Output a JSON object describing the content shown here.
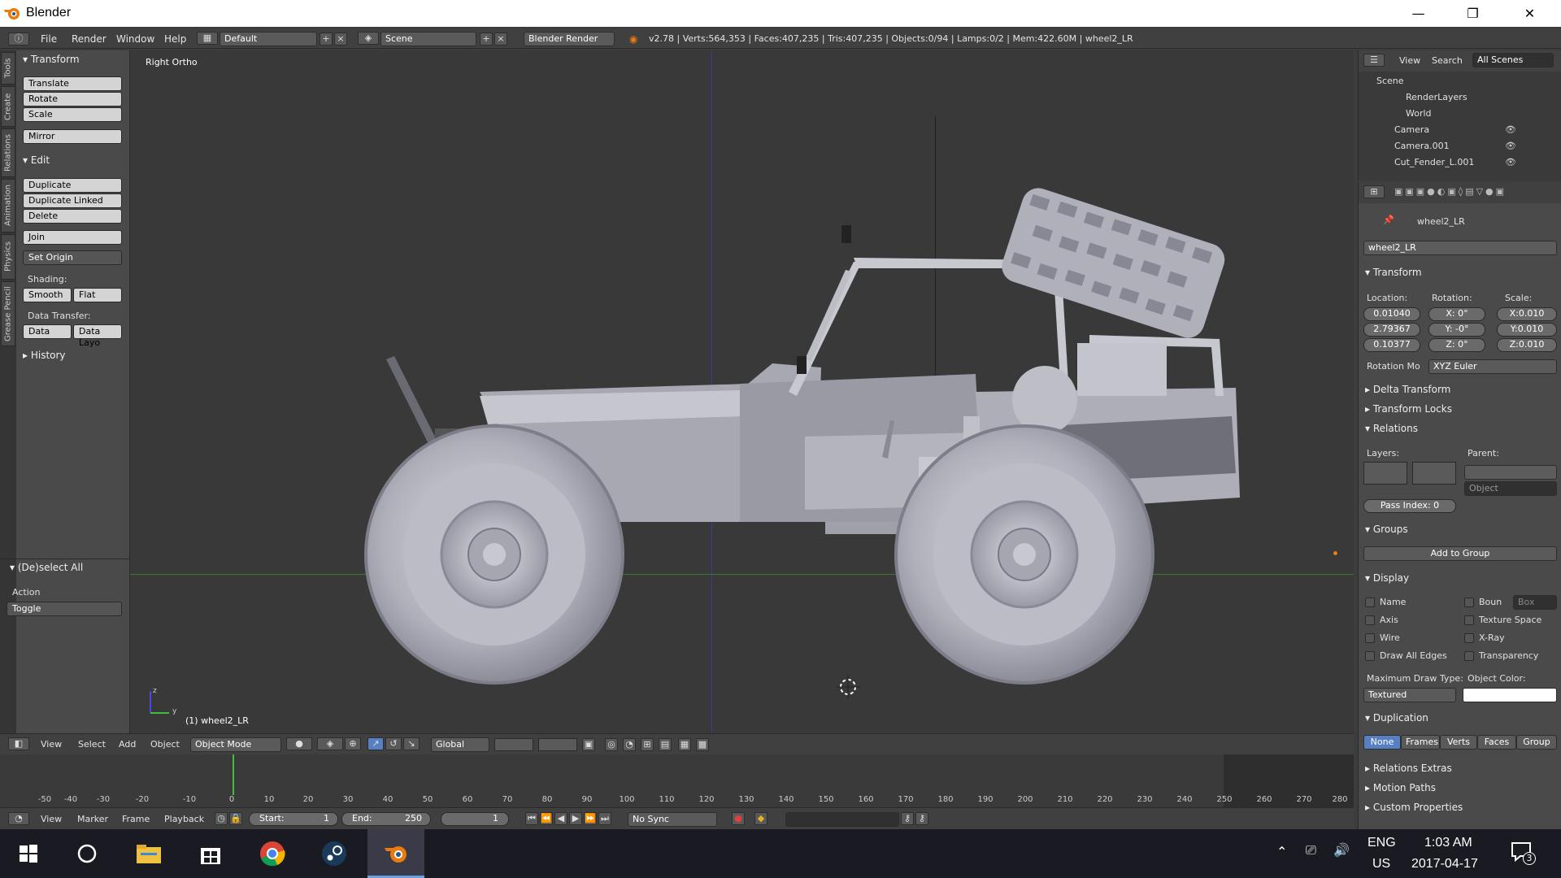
{
  "window": {
    "title": "Blender",
    "minimize": "—",
    "restore": "❐",
    "close": "✕"
  },
  "menubar": {
    "menus": [
      "File",
      "Render",
      "Window",
      "Help"
    ],
    "layout": "Default",
    "scene": "Scene",
    "engine": "Blender Render",
    "stats": "v2.78 | Verts:564,353 | Faces:407,235 | Tris:407,235 | Objects:0/94 | Lamps:0/2 | Mem:422.60M | wheel2_LR"
  },
  "left_tabs": [
    "Tools",
    "Create",
    "Relations",
    "Animation",
    "Physics",
    "Grease Pencil"
  ],
  "tool_shelf": {
    "transform_header": "Transform",
    "transform_buttons": [
      "Translate",
      "Rotate",
      "Scale",
      "Mirror"
    ],
    "edit_header": "Edit",
    "edit_buttons": [
      "Duplicate",
      "Duplicate Linked",
      "Delete",
      "Join"
    ],
    "set_origin": "Set Origin",
    "shading_label": "Shading:",
    "smooth": "Smooth",
    "flat": "Flat",
    "data_transfer_label": "Data Transfer:",
    "data": "Data",
    "data_layo": "Data Layo",
    "history_header": "History",
    "deselect_header": "(De)select All",
    "action_label": "Action",
    "action_value": "Toggle"
  },
  "viewport": {
    "view_label": "Right Ortho",
    "object_label": "(1) wheel2_LR",
    "axis_y": "y",
    "axis_z": "z"
  },
  "outliner": {
    "view": "View",
    "search": "Search",
    "all_scenes": "All Scenes",
    "items": [
      "Scene",
      "RenderLayers",
      "World",
      "Camera",
      "Camera.001",
      "Cut_Fender_L.001"
    ]
  },
  "properties": {
    "object_name_crumb": "wheel2_LR",
    "object_name": "wheel2_LR",
    "transform_header": "Transform",
    "location_label": "Location:",
    "rotation_label": "Rotation:",
    "scale_label": "Scale:",
    "location": [
      "0.01040",
      "2.79367",
      "0.10377"
    ],
    "rotation": [
      "X:",
      "0°",
      "Y:",
      "-0°",
      "Z:",
      "0°"
    ],
    "scale": [
      "X:0.010",
      "Y:0.010",
      "Z:0.010"
    ],
    "rotation_mode_label": "Rotation Mo",
    "rotation_mode": "XYZ Euler",
    "delta_transform": "Delta Transform",
    "transform_locks": "Transform Locks",
    "relations_header": "Relations",
    "layers_label": "Layers:",
    "parent_label": "Parent:",
    "parent_type": "Object",
    "pass_index": "Pass Index:",
    "pass_index_value": "0",
    "groups_header": "Groups",
    "add_to_group": "Add to Group",
    "display_header": "Display",
    "display_left": [
      "Name",
      "Axis",
      "Wire",
      "Draw All Edges"
    ],
    "display_right": [
      "Boun",
      "Texture Space",
      "X-Ray",
      "Transparency"
    ],
    "bounds_type": "Box",
    "max_draw_label": "Maximum Draw Type:",
    "object_color_label": "Object Color:",
    "max_draw_value": "Textured",
    "duplication_header": "Duplication",
    "duplication_tabs": [
      "None",
      "Frames",
      "Verts",
      "Faces",
      "Group"
    ],
    "relations_extras": "Relations Extras",
    "motion_paths": "Motion Paths",
    "custom_properties": "Custom Properties"
  },
  "viewport_header": {
    "menus": [
      "View",
      "Select",
      "Add",
      "Object"
    ],
    "mode": "Object Mode",
    "orientation": "Global"
  },
  "timeline": {
    "ticks": [
      "-50",
      "-40",
      "-30",
      "-20",
      "-10",
      "0",
      "10",
      "20",
      "30",
      "40",
      "50",
      "60",
      "70",
      "80",
      "90",
      "100",
      "110",
      "120",
      "130",
      "140",
      "150",
      "160",
      "170",
      "180",
      "190",
      "200",
      "210",
      "220",
      "230",
      "240",
      "250",
      "260",
      "270",
      "280"
    ],
    "current_frame_marker": 0
  },
  "timeline_header": {
    "menus": [
      "View",
      "Marker",
      "Frame",
      "Playback"
    ],
    "start": "Start:",
    "start_value": "1",
    "end": "End:",
    "end_value": "250",
    "current": "1",
    "sync": "No Sync"
  },
  "taskbar": {
    "lang1": "ENG",
    "lang2": "US",
    "time": "1:03 AM",
    "date": "2017-04-17",
    "notifications": "3"
  },
  "colors": {
    "accent_blue": "#5680c2",
    "timeline_green": "#3fbf3f",
    "grid_green": "#3a7a2a",
    "axis_blue": "#3a3a9a"
  }
}
